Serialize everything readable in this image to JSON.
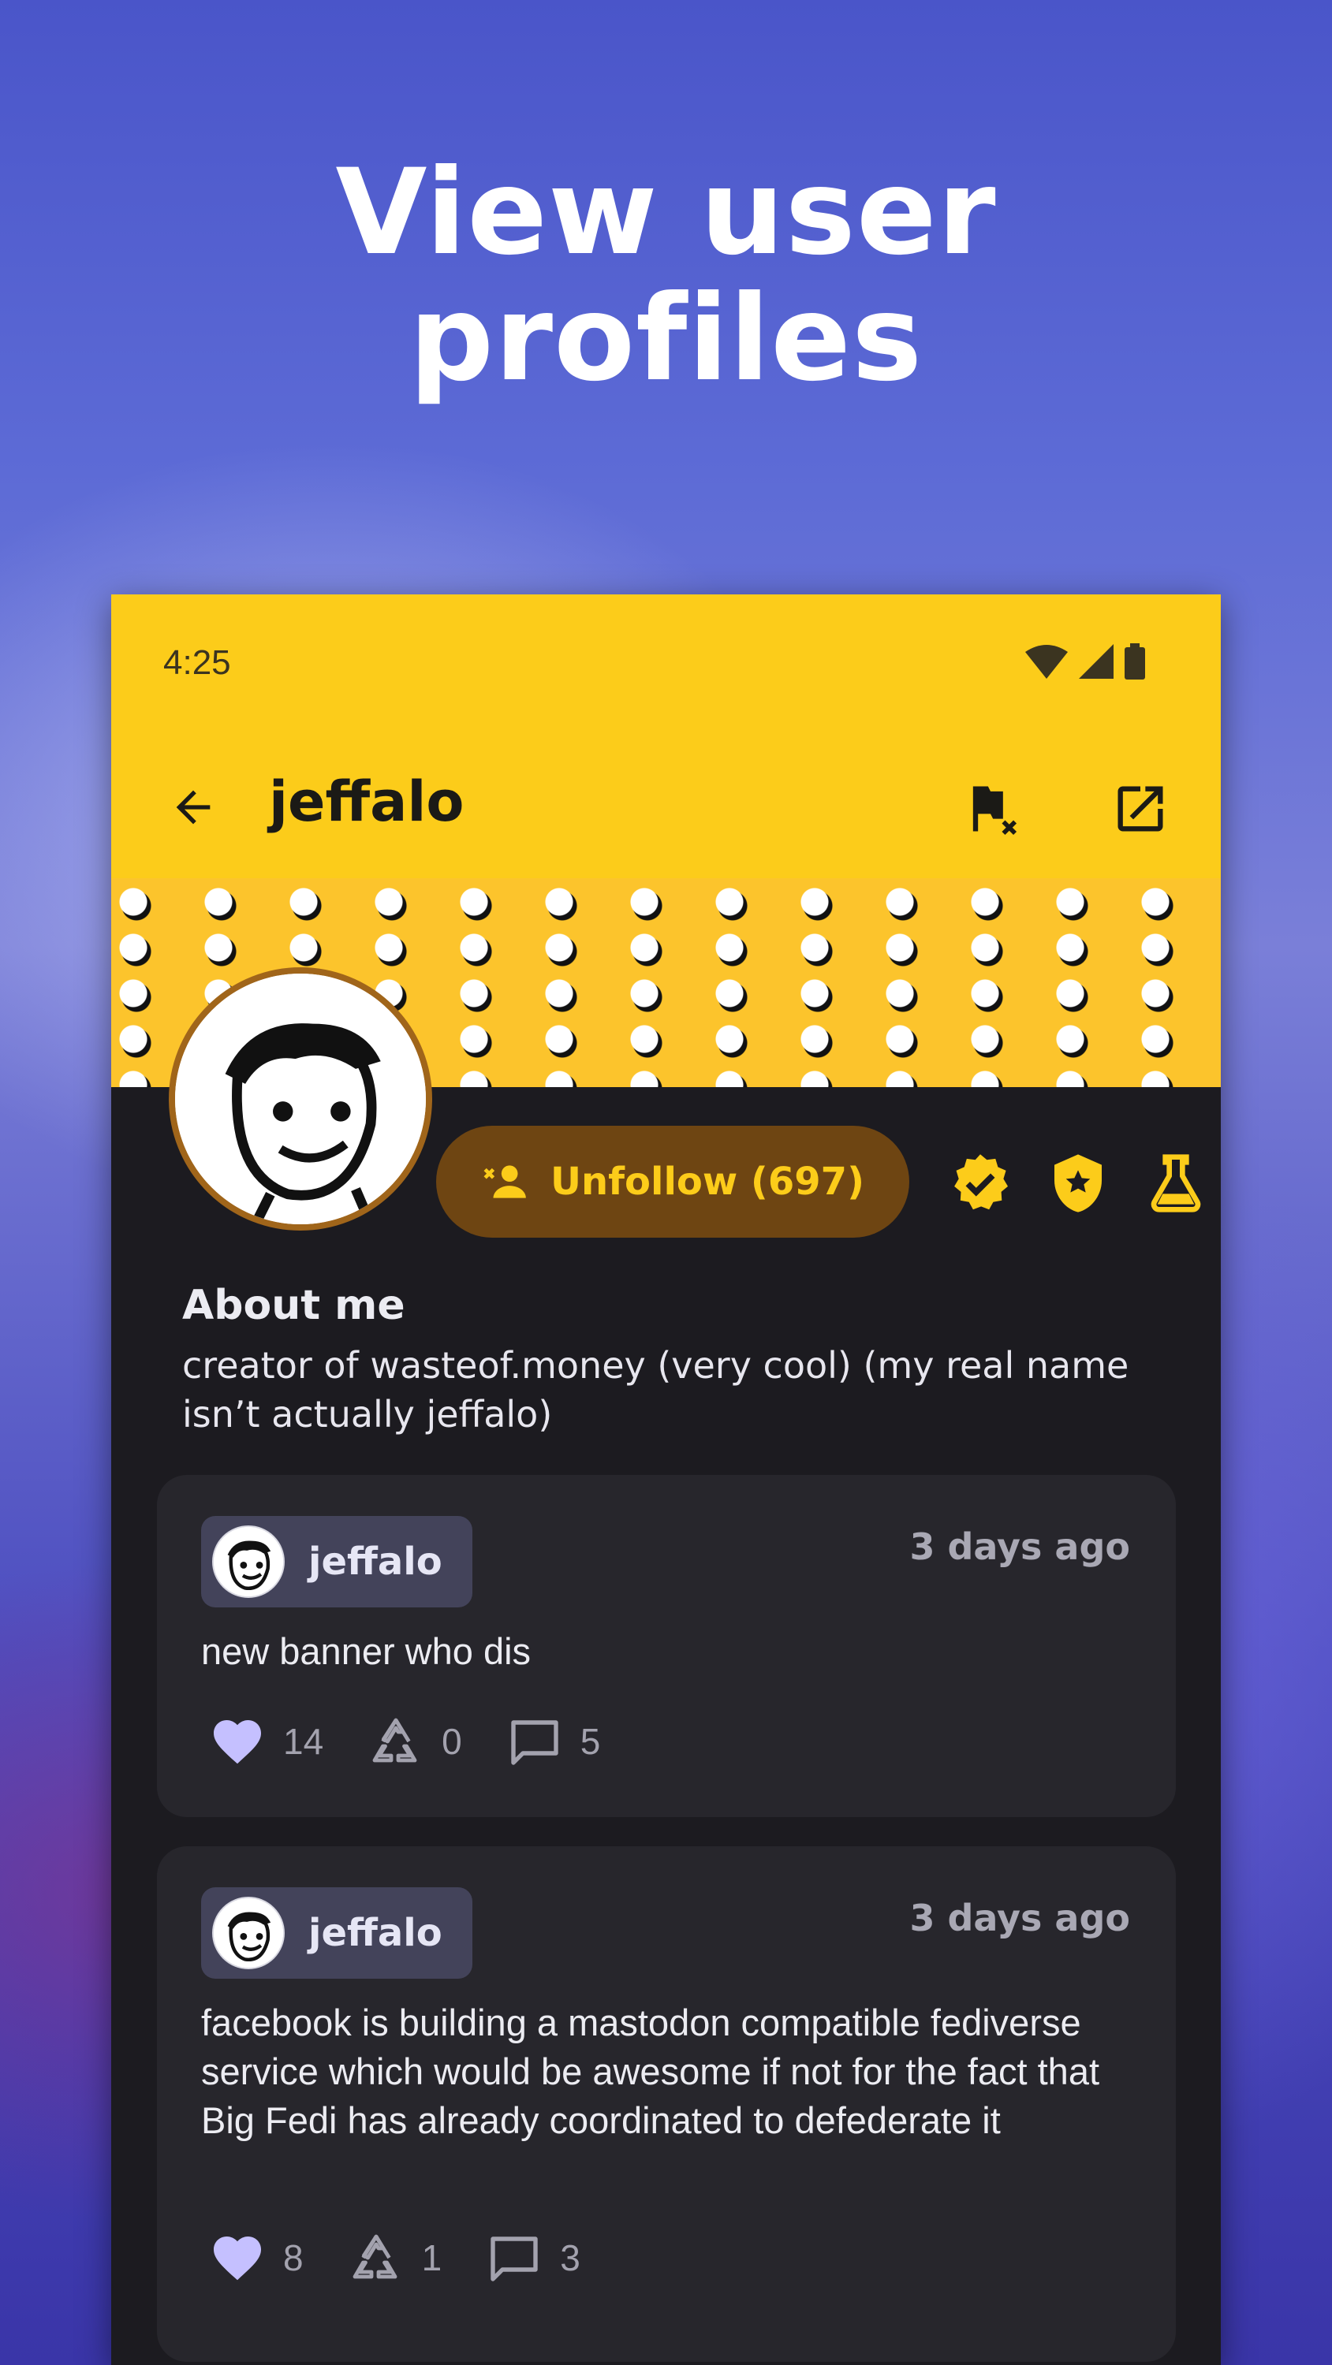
{
  "hero": {
    "line1": "View user",
    "line2": "profiles"
  },
  "status_bar": {
    "time": "4:25"
  },
  "app_bar": {
    "title": "jeffalo"
  },
  "profile": {
    "unfollow_label": "Unfollow (697)",
    "about_title": "About me",
    "about_text": "creator of wasteof.money (very cool) (my real name isn’t actually jeffalo)"
  },
  "posts": [
    {
      "author": "jeffalo",
      "time": "3 days ago",
      "text": "new banner who dis",
      "likes": "14",
      "reposts": "0",
      "comments": "5"
    },
    {
      "author": "jeffalo",
      "time": "3 days ago",
      "text": "facebook is building a mastodon compatible fediverse service which would be awesome if not for the fact that Big Fedi has already coordinated to defederate it",
      "likes": "8",
      "reposts": "1",
      "comments": "3"
    }
  ],
  "colors": {
    "accent": "#fccc1a",
    "button_bg": "#6e4512",
    "surface": "#1c1b20",
    "card": "#27262c",
    "like": "#c5c0ff"
  },
  "icons": [
    "wifi-icon",
    "signal-icon",
    "battery-icon",
    "back-arrow-icon",
    "flag-icon",
    "open-external-icon",
    "person-remove-icon",
    "verified-badge-icon",
    "shield-star-icon",
    "flask-icon",
    "heart-icon",
    "repost-icon",
    "comment-icon"
  ]
}
